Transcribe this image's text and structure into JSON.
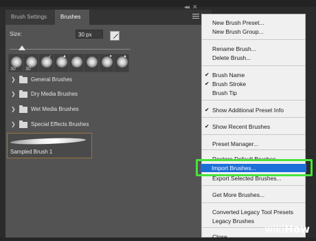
{
  "tabs": [
    "Brush Settings",
    "Brushes"
  ],
  "panel": {
    "size_label": "Size:",
    "size_value": "30 px",
    "slider_value": 0.1,
    "presets": [
      {
        "num": "30",
        "mark": ""
      },
      {
        "num": "30",
        "mark": ""
      },
      {
        "num": "",
        "mark": "✓"
      },
      {
        "num": "",
        "mark": "▲"
      },
      {
        "num": "",
        "mark": ""
      },
      {
        "num": "",
        "mark": ""
      },
      {
        "num": "",
        "mark": "●"
      },
      {
        "num": "",
        "mark": "▲"
      }
    ],
    "groups": [
      "General Brushes",
      "Dry Media Brushes",
      "Wet Media Brushes",
      "Special Effects Brushes"
    ],
    "sampled_brush": "Sampled Brush 1"
  },
  "menu": {
    "items": [
      {
        "label": "New Brush Preset...",
        "checked": false
      },
      {
        "label": "New Brush Group...",
        "checked": false
      },
      {
        "label": "Rename Brush...",
        "checked": false
      },
      {
        "label": "Delete Brush...",
        "checked": false
      },
      {
        "label": "Brush Name",
        "checked": true
      },
      {
        "label": "Brush Stroke",
        "checked": true
      },
      {
        "label": "Brush Tip",
        "checked": false
      },
      {
        "label": "Show Additional Preset Info",
        "checked": true
      },
      {
        "label": "Show Recent Brushes",
        "checked": true
      },
      {
        "label": "Preset Manager...",
        "checked": false
      },
      {
        "label": "Restore Default Brushes",
        "checked": false
      },
      {
        "label": "Import Brushes...",
        "checked": false
      },
      {
        "label": "Export Selected Brushes...",
        "checked": false
      },
      {
        "label": "Get More Brushes...",
        "checked": false
      },
      {
        "label": "Converted Legacy Tool Presets",
        "checked": false
      },
      {
        "label": "Legacy Brushes",
        "checked": false
      },
      {
        "label": "Close",
        "checked": false
      }
    ],
    "highlighted": "Import Brushes..."
  },
  "watermark": {
    "prefix": "wiki",
    "suffix": "How"
  },
  "colors": {
    "highlight": "#1c6fd8",
    "callout": "#48e43b",
    "selected_border": "#9a7440"
  }
}
